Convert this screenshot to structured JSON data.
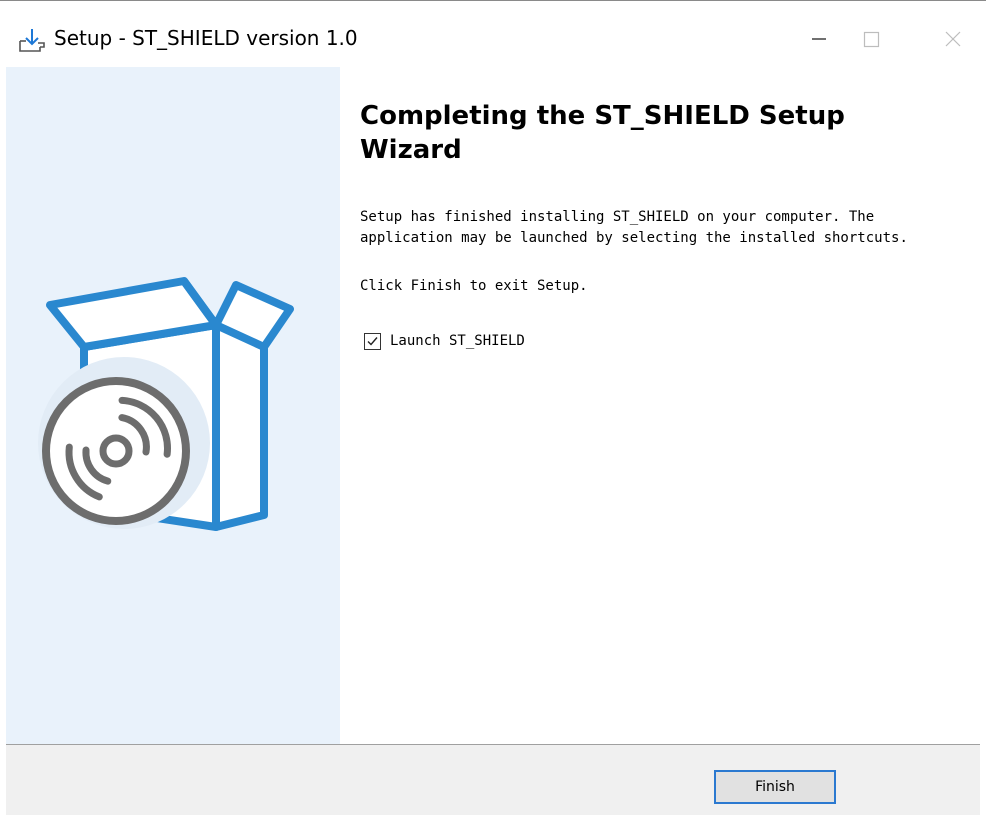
{
  "window": {
    "title": "Setup - ST_SHIELD version 1.0",
    "icon": "installer-download-icon",
    "controls": [
      "minimize-icon",
      "maximize-icon",
      "close-icon"
    ]
  },
  "banner": {
    "illustration": "software-box-with-disc-icon",
    "colors": {
      "background": "#e9f2fb",
      "box_stroke": "#2a88cf",
      "disc": "#6d6d6d"
    }
  },
  "content": {
    "heading": "Completing the ST_SHIELD Setup Wizard",
    "paragraph1": "Setup has finished installing ST_SHIELD on your computer. The application may be launched by selecting the installed shortcuts.",
    "paragraph2": "Click Finish to exit Setup.",
    "launch_checkbox": {
      "label": "Launch ST_SHIELD",
      "checked": true
    }
  },
  "footer": {
    "finish_label": "Finish",
    "accent": "#2b79d0"
  }
}
